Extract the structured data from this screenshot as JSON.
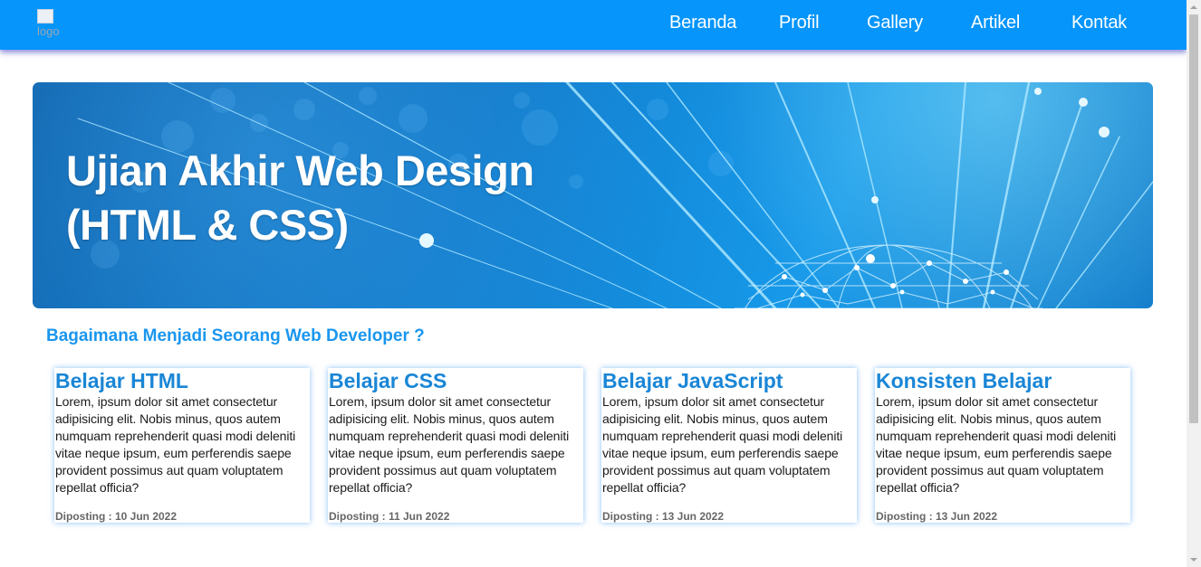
{
  "navbar": {
    "logo_alt": "logo",
    "items": [
      {
        "label": "Beranda"
      },
      {
        "label": "Profil"
      },
      {
        "label": "Gallery"
      },
      {
        "label": "Artikel"
      },
      {
        "label": "Kontak"
      }
    ],
    "background_color": "#0595fb"
  },
  "hero": {
    "title": "Ujian Akhir Web Design\n(HTML & CSS)"
  },
  "section": {
    "title": "Bagaimana Menjadi Seorang Web Developer ?"
  },
  "cards": [
    {
      "title": "Belajar HTML",
      "body": "Lorem, ipsum dolor sit amet consectetur adipisicing elit. Nobis minus, quos autem numquam reprehenderit quasi modi deleniti vitae neque ipsum, eum perferendis saepe provident possimus aut quam voluptatem repellat officia?",
      "date": "Diposting : 10 Jun 2022"
    },
    {
      "title": "Belajar CSS",
      "body": "Lorem, ipsum dolor sit amet consectetur adipisicing elit. Nobis minus, quos autem numquam reprehenderit quasi modi deleniti vitae neque ipsum, eum perferendis saepe provident possimus aut quam voluptatem repellat officia?",
      "date": "Diposting : 11 Jun 2022"
    },
    {
      "title": "Belajar JavaScript",
      "body": "Lorem, ipsum dolor sit amet consectetur adipisicing elit. Nobis minus, quos autem numquam reprehenderit quasi modi deleniti vitae neque ipsum, eum perferendis saepe provident possimus aut quam voluptatem repellat officia?",
      "date": "Diposting : 13 Jun 2022"
    },
    {
      "title": "Konsisten Belajar",
      "body": "Lorem, ipsum dolor sit amet consectetur adipisicing elit. Nobis minus, quos autem numquam reprehenderit quasi modi deleniti vitae neque ipsum, eum perferendis saepe provident possimus aut quam voluptatem repellat officia?",
      "date": "Diposting : 13 Jun 2022"
    }
  ],
  "colors": {
    "accent": "#1a96ee",
    "card_title": "#1a86d6",
    "date_text": "#666666"
  }
}
